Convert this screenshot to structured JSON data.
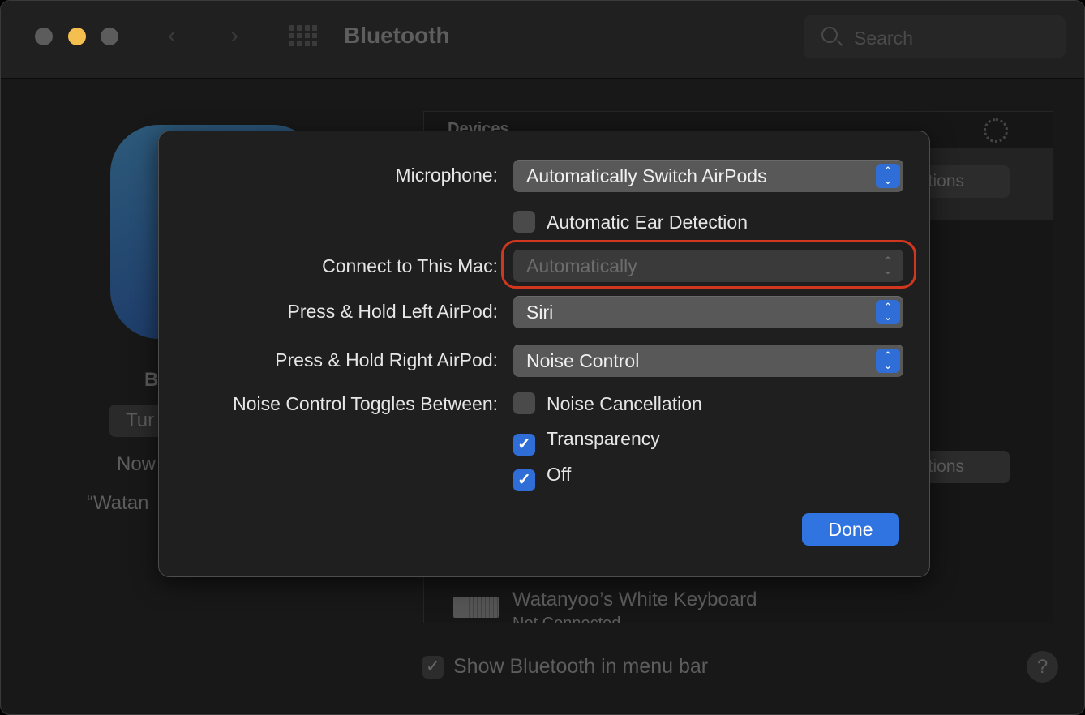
{
  "window": {
    "title": "Bluetooth",
    "search_placeholder": "Search",
    "traffic_light_colors": [
      "#5c5c5c",
      "#f4bf4f",
      "#5c5c5c"
    ]
  },
  "left_panel": {
    "heading_fragment": "B",
    "button_fragment": "Tur",
    "status_fragment": "Now",
    "name_fragment": "“Watan"
  },
  "devices": {
    "header": "Devices",
    "options_label": "ptions",
    "keyboard_name": "Watanyoo’s White Keyboard",
    "keyboard_status": "Not Connected"
  },
  "footer": {
    "show_in_menu_bar": "Show Bluetooth in menu bar",
    "show_in_menu_bar_checked": true,
    "help": "?"
  },
  "sheet": {
    "microphone_label": "Microphone:",
    "microphone_value": "Automatically Switch AirPods",
    "ear_detection_label": "Automatic Ear Detection",
    "ear_detection_checked": false,
    "connect_label": "Connect to This Mac:",
    "connect_value": "Automatically",
    "left_label": "Press & Hold Left AirPod:",
    "left_value": "Siri",
    "right_label": "Press & Hold Right AirPod:",
    "right_value": "Noise Control",
    "noise_label": "Noise Control Toggles Between:",
    "noise_options": [
      {
        "label": "Noise Cancellation",
        "checked": false
      },
      {
        "label": "Transparency",
        "checked": true
      },
      {
        "label": "Off",
        "checked": true
      }
    ],
    "done_label": "Done"
  },
  "colors": {
    "accent": "#2f74e0",
    "highlight": "#d1361f"
  }
}
